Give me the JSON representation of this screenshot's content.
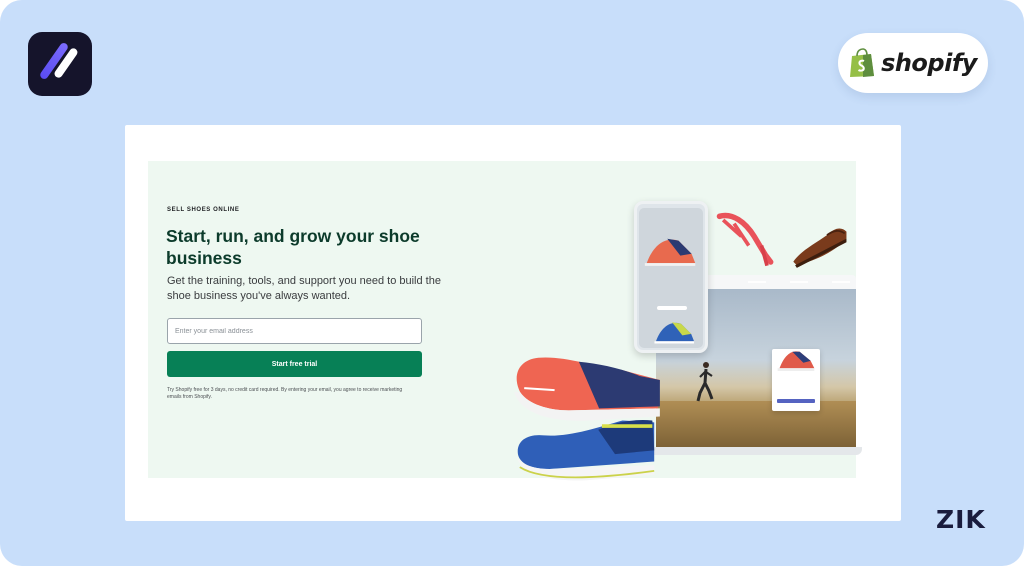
{
  "brand": {
    "shopify_logo_text": "shopify",
    "watermark": "ZIK"
  },
  "hero": {
    "eyebrow": "SELL SHOES ONLINE",
    "headline": "Start, run, and grow your shoe business",
    "subhead": "Get the training, tools, and support you need to build the shoe business you've always wanted.",
    "email_placeholder": "Enter your email address",
    "cta_label": "Start free trial",
    "legal": "Try Shopify free for 3 days, no credit card required. By entering your email, you agree to receive marketing emails from Shopify."
  },
  "colors": {
    "background": "#c8defa",
    "hero_background": "#eef8f1",
    "headline": "#0c3b2b",
    "cta": "#078056",
    "shopify_green": "#95bf47"
  },
  "icons": [
    "app-logo-icon",
    "shopify-bag-icon",
    "running-shoe-icon",
    "dress-shoe-icon",
    "heel-sandal-icon",
    "runner-figure"
  ]
}
